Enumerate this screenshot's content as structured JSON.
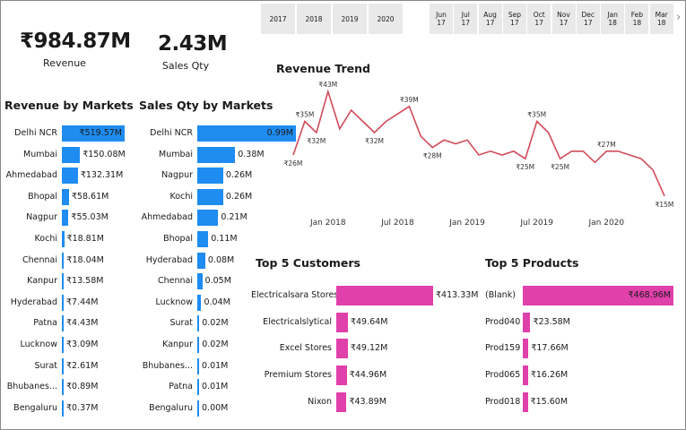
{
  "kpis": {
    "revenue_value": "₹984.87M",
    "revenue_label": "Revenue",
    "qty_value": "2.43M",
    "qty_label": "Sales Qty"
  },
  "year_slicer": [
    "2017",
    "2018",
    "2019",
    "2020"
  ],
  "month_slicer": [
    "Jun\n17",
    "Jul\n17",
    "Aug\n17",
    "Sep\n17",
    "Oct\n17",
    "Nov\n17",
    "Dec\n17",
    "Jan\n18",
    "Feb\n18",
    "Mar\n18"
  ],
  "slicer_next_glyph": "›",
  "chart_data": [
    {
      "type": "bar",
      "orientation": "horizontal",
      "title": "Revenue by Markets",
      "categories": [
        "Delhi NCR",
        "Mumbai",
        "Ahmedabad",
        "Bhopal",
        "Nagpur",
        "Kochi",
        "Chennai",
        "Kanpur",
        "Hyderabad",
        "Patna",
        "Lucknow",
        "Surat",
        "Bhubanes...",
        "Bengaluru"
      ],
      "values": [
        519.57,
        150.08,
        132.31,
        58.61,
        55.03,
        18.81,
        18.04,
        13.58,
        7.44,
        4.43,
        3.09,
        2.61,
        0.89,
        0.37
      ],
      "labels": [
        "₹519.57M",
        "₹150.08M",
        "₹132.31M",
        "₹58.61M",
        "₹55.03M",
        "₹18.81M",
        "₹18.04M",
        "₹13.58M",
        "₹7.44M",
        "₹4.43M",
        "₹3.09M",
        "₹2.61M",
        "₹0.89M",
        "₹0.37M"
      ],
      "color": "#1e8cf0"
    },
    {
      "type": "bar",
      "orientation": "horizontal",
      "title": "Sales Qty by Markets",
      "categories": [
        "Delhi NCR",
        "Mumbai",
        "Nagpur",
        "Kochi",
        "Ahmedabad",
        "Bhopal",
        "Hyderabad",
        "Chennai",
        "Lucknow",
        "Surat",
        "Kanpur",
        "Bhubanes...",
        "Patna",
        "Bengaluru"
      ],
      "values": [
        0.99,
        0.38,
        0.26,
        0.26,
        0.21,
        0.11,
        0.08,
        0.05,
        0.04,
        0.02,
        0.02,
        0.01,
        0.01,
        0.0
      ],
      "labels": [
        "0.99M",
        "0.38M",
        "0.26M",
        "0.26M",
        "0.21M",
        "0.11M",
        "0.08M",
        "0.05M",
        "0.04M",
        "0.02M",
        "0.02M",
        "0.01M",
        "0.01M",
        "0.00M"
      ],
      "color": "#1e8cf0"
    },
    {
      "type": "line",
      "title": "Revenue Trend",
      "x_ticks": [
        "Jan 2018",
        "Jul 2018",
        "Jan 2019",
        "Jul 2019",
        "Jan 2020"
      ],
      "x": [
        "2017-10",
        "2017-11",
        "2017-12",
        "2018-01",
        "2018-02",
        "2018-03",
        "2018-04",
        "2018-05",
        "2018-06",
        "2018-07",
        "2018-08",
        "2018-09",
        "2018-10",
        "2018-11",
        "2018-12",
        "2019-01",
        "2019-02",
        "2019-03",
        "2019-04",
        "2019-05",
        "2019-06",
        "2019-07",
        "2019-08",
        "2019-09",
        "2019-10",
        "2019-11",
        "2019-12",
        "2020-01",
        "2020-02",
        "2020-03",
        "2020-04",
        "2020-05",
        "2020-06"
      ],
      "values": [
        26,
        35,
        32,
        43,
        33,
        38,
        35,
        32,
        35,
        37,
        39,
        31,
        28,
        30,
        29,
        30,
        26,
        27,
        26,
        27,
        25,
        35,
        32,
        25,
        27,
        27,
        24,
        27,
        27,
        26,
        25,
        22,
        15
      ],
      "point_labels": [
        {
          "index": 0,
          "text": "₹26M"
        },
        {
          "index": 1,
          "text": "₹35M"
        },
        {
          "index": 2,
          "text": "₹32M"
        },
        {
          "index": 3,
          "text": "₹43M"
        },
        {
          "index": 7,
          "text": "₹32M"
        },
        {
          "index": 10,
          "text": "₹39M"
        },
        {
          "index": 12,
          "text": "₹28M"
        },
        {
          "index": 20,
          "text": "₹25M"
        },
        {
          "index": 21,
          "text": "₹35M"
        },
        {
          "index": 23,
          "text": "₹25M"
        },
        {
          "index": 27,
          "text": "₹27M"
        },
        {
          "index": 32,
          "text": "₹15M"
        }
      ],
      "color": "#d14b5a"
    },
    {
      "type": "bar",
      "orientation": "horizontal",
      "title": "Top 5 Customers",
      "categories": [
        "Electricalsara Stores",
        "Electricalslytical",
        "Excel Stores",
        "Premium Stores",
        "Nixon"
      ],
      "values": [
        413.33,
        49.64,
        49.12,
        44.96,
        43.89
      ],
      "labels": [
        "₹413.33M",
        "₹49.64M",
        "₹49.12M",
        "₹44.96M",
        "₹43.89M"
      ],
      "color": "#e040aa"
    },
    {
      "type": "bar",
      "orientation": "horizontal",
      "title": "Top 5 Products",
      "categories": [
        "(Blank)",
        "Prod040",
        "Prod159",
        "Prod065",
        "Prod018"
      ],
      "values": [
        468.96,
        23.58,
        17.66,
        16.26,
        15.6
      ],
      "labels": [
        "₹468.96M",
        "₹23.58M",
        "₹17.66M",
        "₹16.26M",
        "₹15.60M"
      ],
      "color": "#e040aa"
    }
  ]
}
